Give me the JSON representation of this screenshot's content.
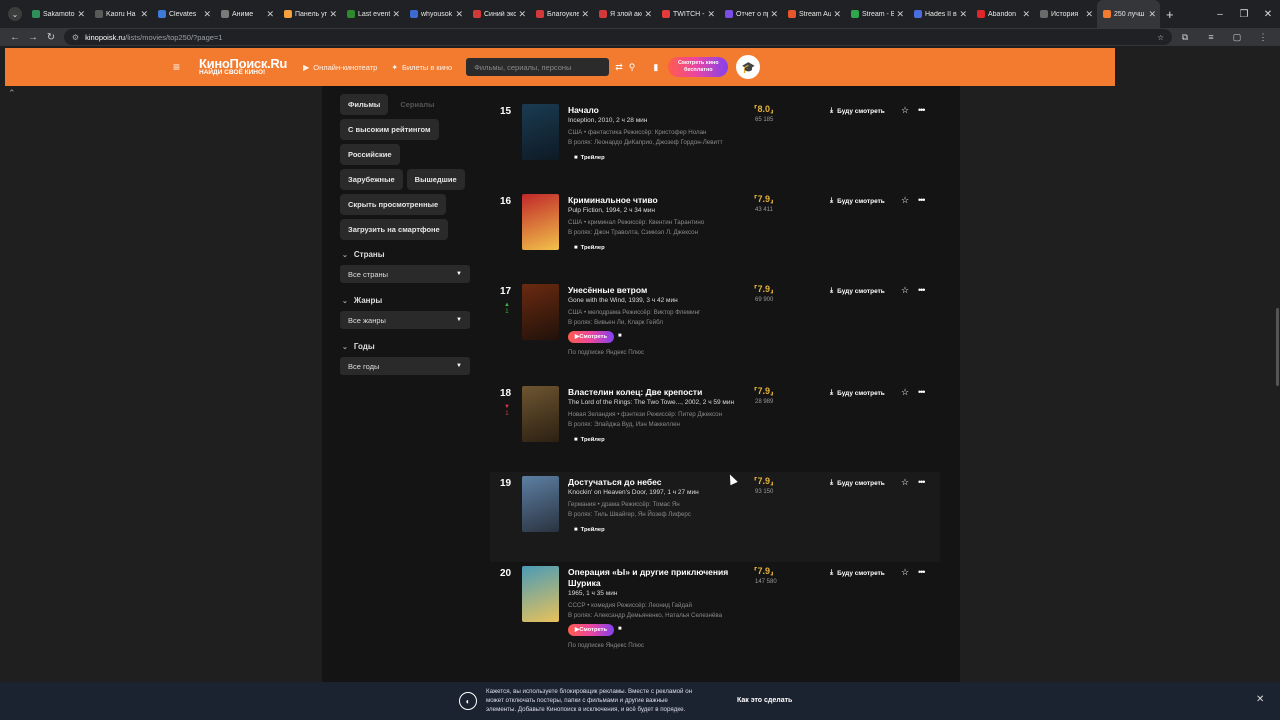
{
  "browser": {
    "tabs": [
      {
        "title": "Sakamoto",
        "color": "#2f8f5b"
      },
      {
        "title": "Kaoru Ha",
        "color": "#5a5a5a"
      },
      {
        "title": "Clevates",
        "color": "#3f7ad8"
      },
      {
        "title": "Аниме",
        "color": "#7a7a7a"
      },
      {
        "title": "Панель уп",
        "color": "#f4a23c"
      },
      {
        "title": "Last event",
        "color": "#2d8a2d"
      },
      {
        "title": "whyousok",
        "color": "#3b6bd1"
      },
      {
        "title": "Синий экс",
        "color": "#d23a3a"
      },
      {
        "title": "Благоукле",
        "color": "#d23a3a"
      },
      {
        "title": "Я злой ако",
        "color": "#d23a3a"
      },
      {
        "title": "TWITCH -",
        "color": "#e23b3b"
      },
      {
        "title": "Отчет о пр",
        "color": "#7c4de6"
      },
      {
        "title": "Stream Au",
        "color": "#e8572c"
      },
      {
        "title": "Stream - В",
        "color": "#2fa84b"
      },
      {
        "title": "Hades II в",
        "color": "#4a6de0"
      },
      {
        "title": "Abandon",
        "color": "#e0262a"
      },
      {
        "title": "История",
        "color": "#6a6a6a"
      },
      {
        "title": "250 лучш",
        "color": "#f27b2f"
      }
    ],
    "url_host": "kinopoisk.ru",
    "url_path": "/lists/movies/top250/?page=1"
  },
  "header": {
    "logo_main": "КиноПоиск.Ru",
    "logo_tagline": "НАЙДИ СВОЁ КИНО!",
    "link_online": "Онлайн-кинотеатр",
    "link_tickets": "Билеты в кино",
    "search_placeholder": "Фильмы, сериалы, персоны",
    "promo_line1": "Смотреть кино",
    "promo_line2": "бесплатно"
  },
  "sidebar": {
    "tab_films": "Фильмы",
    "tab_series": "Сериалы",
    "high_rating": "С высоким рейтингом",
    "russian": "Российские",
    "foreign": "Зарубежные",
    "released": "Вышедшие",
    "hide_watched": "Скрыть просмотренные",
    "download": "Загрузить на смартфоне",
    "countries_title": "Страны",
    "countries_value": "Все страны",
    "genres_title": "Жанры",
    "genres_value": "Все жанры",
    "years_title": "Годы",
    "years_value": "Все годы"
  },
  "movies": [
    {
      "pos": "15",
      "title": "Начало",
      "orig": "Inception, 2010, 2 ч 28 мин",
      "info": "США • фантастика  Режиссёр: Кристофер Нолан",
      "cast": "В ролях: Леонардо ДиКаприо, Джозеф Гордон-Левитт",
      "rating": "8.0",
      "votes": "65 185",
      "trailer": "Трейлер",
      "poster": [
        "#1b3b52",
        "#0d1a24"
      ],
      "trend": ""
    },
    {
      "pos": "16",
      "title": "Криминальное чтиво",
      "orig": "Pulp Fiction, 1994, 2 ч 34 мин",
      "info": "США • криминал  Режиссёр: Квентин Тарантино",
      "cast": "В ролях: Джон Траволта, Сэмюэл Л. Джексон",
      "rating": "7.9",
      "votes": "43 411",
      "trailer": "Трейлер",
      "poster": [
        "#c0282a",
        "#f2c24a"
      ],
      "trend": ""
    },
    {
      "pos": "17",
      "title": "Унесённые ветром",
      "orig": "Gone with the Wind, 1939, 3 ч 42 мин",
      "info": "США • мелодрама  Режиссёр: Виктор Флеминг",
      "cast": "В ролях: Вивьен Ли, Кларк Гейбл",
      "rating": "7.9",
      "votes": "69 900",
      "watch": "Смотреть",
      "sub": "По подписке Яндекс Плюс",
      "poster": [
        "#6b2a10",
        "#20110a"
      ],
      "trend": "up",
      "trend_value": "1"
    },
    {
      "pos": "18",
      "title": "Властелин колец: Две крепости",
      "orig": "The Lord of the Rings: The Two Towe..., 2002, 2 ч 59 мин",
      "info": "Новая Зеландия • фэнтези  Режиссёр: Питер Джексон",
      "cast": "В ролях: Элайджа Вуд, Иэн Маккеллен",
      "rating": "7.9",
      "votes": "28 989",
      "trailer": "Трейлер",
      "poster": [
        "#6e5531",
        "#2b2012"
      ],
      "trend": "down",
      "trend_value": "1"
    },
    {
      "pos": "19",
      "title": "Достучаться до небес",
      "orig": "Knockin' on Heaven's Door, 1997, 1 ч 27 мин",
      "info": "Германия • драма  Режиссёр: Томас Ян",
      "cast": "В ролях: Тиль Швайгер, Ян Йозеф Лиферс",
      "rating": "7.9",
      "votes": "93 150",
      "trailer": "Трейлер",
      "poster": [
        "#5d7fa3",
        "#2a3340"
      ],
      "trend": ""
    },
    {
      "pos": "20",
      "title": "Операция «Ы» и другие приключения Шурика",
      "orig": "1965, 1 ч 35 мин",
      "info": "СССР • комедия  Режиссёр: Леонид Гайдай",
      "cast": "В ролях: Александр Демьяненко, Наталья Селезнёва",
      "rating": "7.9",
      "votes": "147 580",
      "watch": "Смотреть",
      "sub": "По подписке Яндекс Плюс",
      "poster": [
        "#4a9bb7",
        "#e9c25a"
      ],
      "trend": ""
    }
  ],
  "actions": {
    "later": "Буду смотреть"
  },
  "adblock": {
    "line1": "Кажется, вы используете блокировщик рекламы. Вместе с рекламой он",
    "line2": "может отключать постеры, папки с фильмами и другие важные",
    "line3": "элементы. Добавьте Кинопоиск в исключения, и всё будет в порядке.",
    "how": "Как это сделать"
  }
}
